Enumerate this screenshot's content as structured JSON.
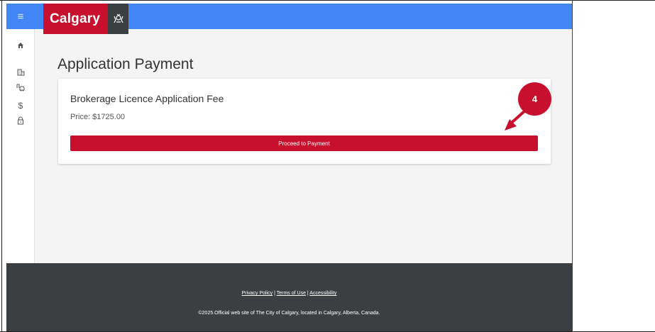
{
  "header": {
    "menu_icon": "hamburger-menu-icon",
    "brand": "Calgary",
    "crest_icon": "city-crest-icon",
    "color": "#4285f4",
    "brand_color": "#c8102e"
  },
  "sidebar": {
    "items": [
      {
        "icon": "home-icon",
        "glyph": "⌂"
      },
      {
        "icon": "building-icon",
        "glyph": "▥"
      },
      {
        "icon": "vehicle-icon",
        "glyph": "⛟"
      },
      {
        "icon": "dollar-icon",
        "glyph": "$"
      },
      {
        "icon": "lock-icon",
        "glyph": "🔒"
      }
    ]
  },
  "main": {
    "page_title": "Application Payment",
    "card": {
      "title": "Brokerage Licence Application Fee",
      "price": "Price: $1725.00",
      "button_label": "Proceed to Payment"
    }
  },
  "annotation": {
    "step_number": "4",
    "color": "#c8102e"
  },
  "footer": {
    "links": [
      "Privacy Policy",
      "Terms of Use",
      "Accessibility"
    ],
    "separator": " | ",
    "copyright": "©2025.Official web site of The City of Calgary, located in Calgary, Alberta, Canada.",
    "background": "#3c3f42"
  }
}
